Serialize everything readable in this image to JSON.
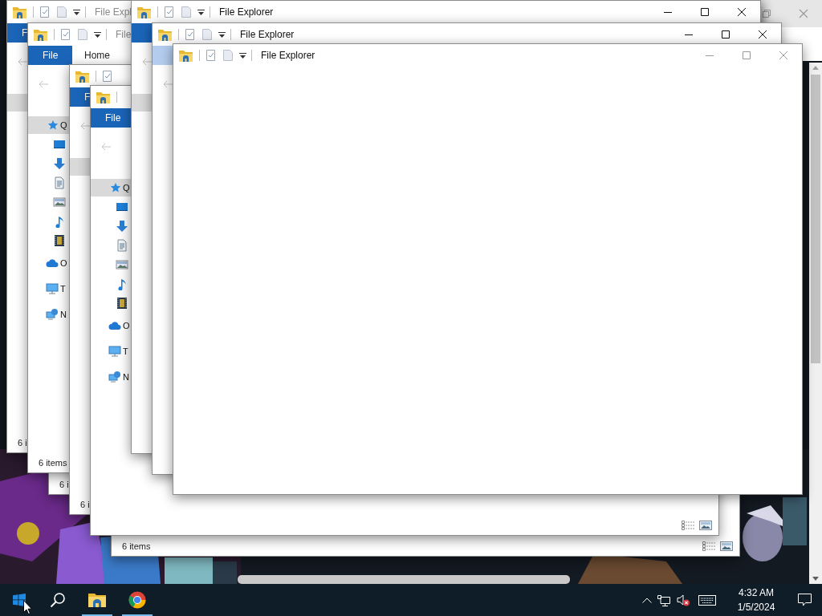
{
  "windows": [
    {
      "title": "File Expl",
      "title_dimmed": true,
      "file_tab": {
        "label": "F",
        "hovered": false
      },
      "nav_items": [
        {
          "kind": "quick-access",
          "selected": true
        }
      ],
      "status": "6 i"
    },
    {
      "title": "File",
      "title_dimmed": true,
      "file_tab": {
        "label": "File",
        "hovered": false
      },
      "home_tab": "Home",
      "nav_items": [
        {
          "kind": "quick-access",
          "label": "Q",
          "selected": true
        },
        {
          "kind": "desktop",
          "selected": false
        },
        {
          "kind": "downloads",
          "selected": false
        },
        {
          "kind": "documents",
          "selected": false
        },
        {
          "kind": "pictures",
          "selected": false
        },
        {
          "kind": "music",
          "selected": false
        },
        {
          "kind": "videos",
          "selected": false
        },
        {
          "kind": "onedrive",
          "label": "O",
          "selected": false
        },
        {
          "kind": "this-pc",
          "label": "T",
          "selected": false
        },
        {
          "kind": "network",
          "label": "N",
          "selected": false
        }
      ],
      "status": "6 items"
    },
    {
      "status": "6 i"
    },
    {
      "file_tab": {
        "label": "F",
        "hovered": false
      },
      "nav_items": [
        {
          "kind": "quick-access",
          "selected": true
        }
      ],
      "status": "6 i"
    },
    {
      "status": "6 items",
      "view_buttons": true
    },
    {
      "file_tab": {
        "label": "File",
        "hovered": false
      },
      "nav_items": [
        {
          "kind": "quick-access",
          "label": "Q",
          "selected": true
        },
        {
          "kind": "desktop",
          "selected": false
        },
        {
          "kind": "downloads",
          "selected": false
        },
        {
          "kind": "documents",
          "selected": false
        },
        {
          "kind": "pictures",
          "selected": false
        },
        {
          "kind": "music",
          "selected": false
        },
        {
          "kind": "videos",
          "selected": false
        },
        {
          "kind": "onedrive",
          "label": "O",
          "selected": false
        },
        {
          "kind": "this-pc",
          "label": "T",
          "selected": false
        },
        {
          "kind": "network",
          "label": "N",
          "selected": false
        }
      ],
      "view_buttons": true
    },
    {
      "title": "File Explorer",
      "title_dimmed": false,
      "active": true,
      "file_tab": {
        "hovered": false
      },
      "nav_items": [
        {
          "kind": "quick-access",
          "selected": true
        }
      ]
    },
    {
      "title": "File Explorer",
      "title_dimmed": false,
      "active": true,
      "file_tab": {
        "hovered": true
      }
    },
    {
      "title": "File Explorer",
      "title_dimmed": false,
      "active": false
    }
  ],
  "taskbar": {
    "pinned": [
      {
        "kind": "file-explorer",
        "running": true
      },
      {
        "kind": "chrome",
        "running": true
      }
    ],
    "tray": {
      "volume_muted": true,
      "time": "4:32 AM",
      "date": "1/5/2024"
    }
  }
}
